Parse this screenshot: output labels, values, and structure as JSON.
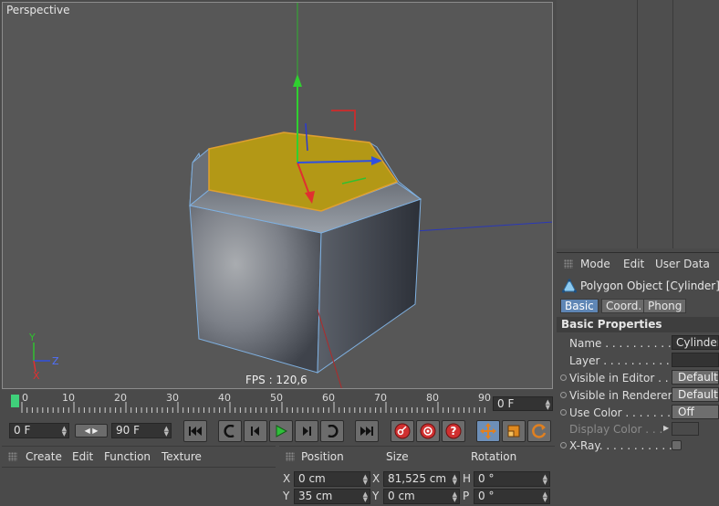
{
  "viewport": {
    "title": "Perspective",
    "fps": "FPS : 120,6",
    "axis_y": "Y",
    "axis_z": "Z",
    "axis_x": "X"
  },
  "attributes": {
    "menu": [
      "Mode",
      "Edit",
      "User Data"
    ],
    "object_title": "Polygon Object [Cylinder]",
    "tabs": [
      "Basic",
      "Coord.",
      "Phong"
    ],
    "active_tab": "Basic",
    "section": "Basic Properties",
    "props": {
      "name_label": "Name . . . . . . . . . . . .",
      "name_value": "Cylinder",
      "layer_label": "Layer . . . . . . . . . . . .",
      "layer_value": "",
      "vis_editor_label": "Visible in Editor . . .",
      "vis_editor_value": "Default",
      "vis_render_label": "Visible in Renderer",
      "vis_render_value": "Default",
      "use_color_label": "Use Color . . . . . . . .",
      "use_color_value": "Off",
      "display_color_label": "Display Color . . .",
      "xray_label": "X-Ray. . . . . . . . . . . ."
    }
  },
  "timeline": {
    "ticks": [
      "0",
      "10",
      "20",
      "30",
      "40",
      "50",
      "60",
      "70",
      "80",
      "90"
    ],
    "current_frame": "0 F"
  },
  "transport": {
    "start_frame": "0 F",
    "end_frame": "90 F"
  },
  "material_menu": [
    "Create",
    "Edit",
    "Function",
    "Texture"
  ],
  "coords": {
    "headers": [
      "Position",
      "Size",
      "Rotation"
    ],
    "row1": {
      "pos_axis": "X",
      "pos_value": "0 cm",
      "size_axis": "X",
      "size_value": "81,525 cm",
      "rot_axis": "H",
      "rot_value": "0 °"
    },
    "row2": {
      "pos_axis": "Y",
      "pos_value": "35 cm",
      "size_axis": "Y",
      "size_value": "0 cm",
      "rot_axis": "P",
      "rot_value": "0 °"
    }
  },
  "colors": {
    "accent": "#5f86b5",
    "selection_face": "#b79a1a",
    "axis_x": "#e03030",
    "axis_y": "#30c030",
    "axis_z": "#3050e0"
  }
}
